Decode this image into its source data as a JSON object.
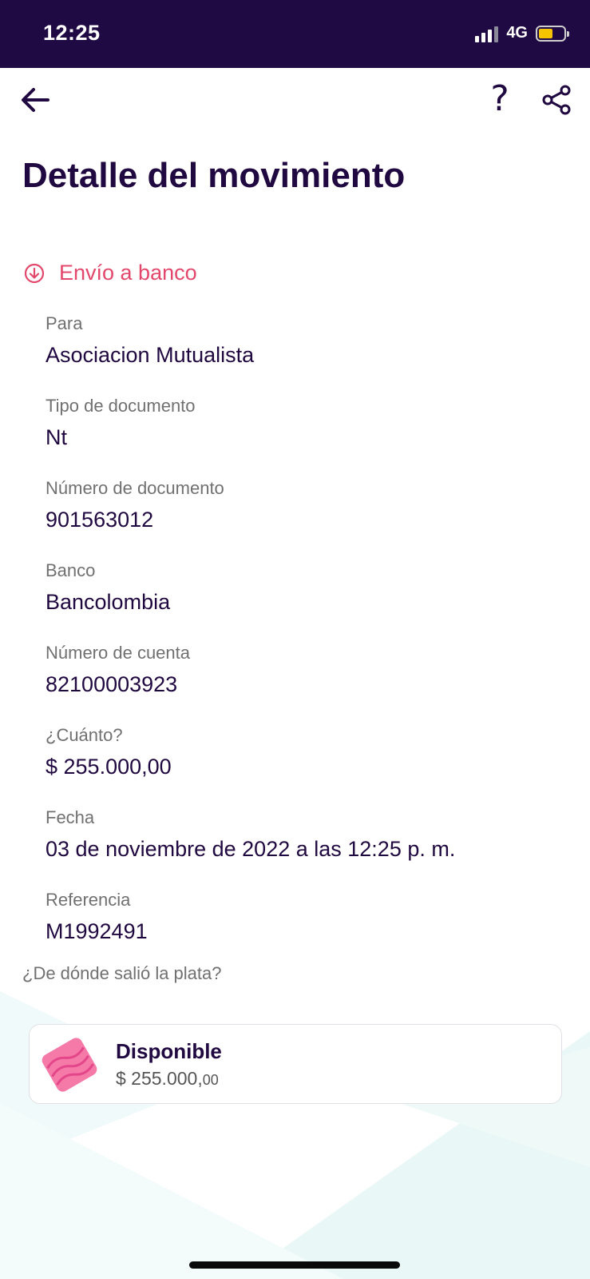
{
  "status_bar": {
    "time": "12:25",
    "network": "4G",
    "battery_color": "#f5c400"
  },
  "nav": {
    "back_icon": "arrow-left-icon",
    "help_label": "?",
    "share_icon": "share-icon"
  },
  "title": "Detalle del movimiento",
  "movement_type": {
    "icon": "arrow-down-circle-icon",
    "label": "Envío a banco",
    "color": "#e3476b"
  },
  "details": [
    {
      "label": "Para",
      "value": "Asociacion Mutualista"
    },
    {
      "label": "Tipo de documento",
      "value": "Nt"
    },
    {
      "label": "Número de documento",
      "value": "901563012"
    },
    {
      "label": "Banco",
      "value": "Bancolombia"
    },
    {
      "label": "Número de cuenta",
      "value": "82100003923"
    },
    {
      "label": "¿Cuánto?",
      "value": "$ 255.000,00"
    },
    {
      "label": "Fecha",
      "value": "03 de noviembre de 2022 a las 12:25 p. m."
    },
    {
      "label": "Referencia",
      "value": "M1992491"
    }
  ],
  "source": {
    "question": "¿De dónde salió la plata?",
    "card": {
      "icon": "pocket-pink-icon",
      "title": "Disponible",
      "amount_main": "$ 255.000,",
      "amount_cents": "00"
    }
  },
  "colors": {
    "primary": "#200840",
    "status_bar_bg": "#200a44",
    "accent": "#e3476b"
  }
}
